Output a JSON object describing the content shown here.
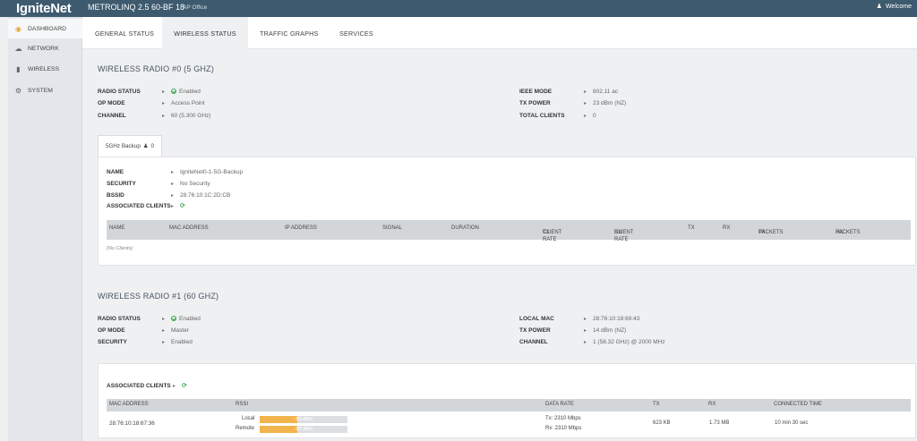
{
  "header": {
    "logo": "IgniteNet",
    "device_title": "METROLINQ 2.5 60-BF 18",
    "location": "AP Office",
    "welcome": "Welcome"
  },
  "sidebar": {
    "items": [
      {
        "label": "DASHBOARD",
        "icon": "dashboard-icon"
      },
      {
        "label": "NETWORK",
        "icon": "cloud-icon"
      },
      {
        "label": "WIRELESS",
        "icon": "signal-bars-icon"
      },
      {
        "label": "SYSTEM",
        "icon": "gear-icon"
      }
    ]
  },
  "tabs": [
    {
      "label": "GENERAL STATUS"
    },
    {
      "label": "WIRELESS STATUS"
    },
    {
      "label": "TRAFFIC GRAPHS"
    },
    {
      "label": "SERVICES"
    }
  ],
  "radio0": {
    "title": "WIRELESS RADIO #0 (5 GHZ)",
    "left": [
      {
        "k": "RADIO STATUS",
        "v": "Enabled"
      },
      {
        "k": "OP MODE",
        "v": "Access Point"
      },
      {
        "k": "CHANNEL",
        "v": "60 (5.300 GHz)"
      }
    ],
    "right": [
      {
        "k": "IEEE MODE",
        "v": "802.11 ac"
      },
      {
        "k": "TX POWER",
        "v": "23 dBm (NZ)"
      },
      {
        "k": "TOTAL CLIENTS",
        "v": "0"
      }
    ],
    "ssid_tab": {
      "label": "5GHz Backup",
      "count": "0"
    },
    "ssid": [
      {
        "k": "NAME",
        "v": "IgniteNet0-1-5G-Backup"
      },
      {
        "k": "SECURITY",
        "v": "No Security"
      },
      {
        "k": "BSSID",
        "v": "28:76:10:1C:2D:CB"
      },
      {
        "k": "ASSOCIATED CLIENTS",
        "v": ""
      }
    ],
    "columns": [
      {
        "l1": "NAME",
        "l2": ""
      },
      {
        "l1": "MAC ADDRESS",
        "l2": ""
      },
      {
        "l1": "IP ADDRESS",
        "l2": ""
      },
      {
        "l1": "SIGNAL",
        "l2": ""
      },
      {
        "l1": "DURATION",
        "l2": ""
      },
      {
        "l1": "CLIENT",
        "l2": "TX RATE"
      },
      {
        "l1": "CLIENT",
        "l2": "RX RATE"
      },
      {
        "l1": "TX",
        "l2": ""
      },
      {
        "l1": "RX",
        "l2": ""
      },
      {
        "l1": "TX",
        "l2": "PACKETS"
      },
      {
        "l1": "RX",
        "l2": "PACKETS"
      }
    ],
    "empty": "(No Clients)"
  },
  "radio1": {
    "title": "WIRELESS RADIO #1 (60 GHZ)",
    "left": [
      {
        "k": "RADIO STATUS",
        "v": "Enabled"
      },
      {
        "k": "OP MODE",
        "v": "Master"
      },
      {
        "k": "SECURITY",
        "v": "Enabled"
      }
    ],
    "right": [
      {
        "k": "LOCAL MAC",
        "v": "28:76:10:18:69:43"
      },
      {
        "k": "TX POWER",
        "v": "14 dBm (NZ)"
      },
      {
        "k": "CHANNEL",
        "v": "1 (58.32 GHz) @ 2000 MHz"
      }
    ],
    "assoc_label": "ASSOCIATED CLIENTS",
    "columns": [
      "MAC ADDRESS",
      "RSSI",
      "DATA RATE",
      "TX",
      "RX",
      "CONNECTED TIME"
    ],
    "client": {
      "mac": "28:76:10:18:67:36",
      "local_label": "Local",
      "remote_label": "Remote",
      "local_rssi": "-55 dBm",
      "remote_rssi": "-55 dBm",
      "local_fraction": 0.43,
      "remote_fraction": 0.43,
      "tx_rate": "Tx: 2310 Mbps",
      "rx_rate": "Rx: 2310 Mbps",
      "tx": "623 KB",
      "rx": "1.73 MB",
      "connected": "10 min 30 sec"
    }
  },
  "colors": {
    "header_bg": "#3d5a6e",
    "ok_green": "#3aa64b",
    "rssi_bar": "#f2b44c",
    "active_icon": "#e8a43a"
  }
}
